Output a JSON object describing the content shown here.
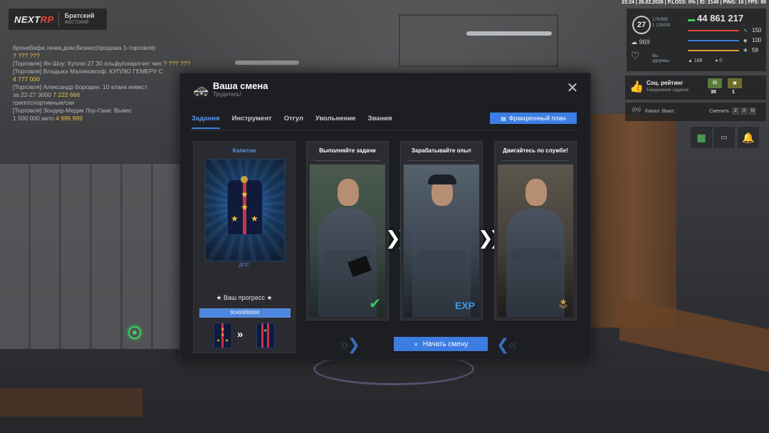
{
  "hud": {
    "status_line": "23:24 | 26.02.2026 | P.LOSS: 0% | ID: 2149 | PING: 16 | FPS: 90",
    "level": "27",
    "level_sub_1": "175/995",
    "level_sub_2": "1 125000",
    "money": "44 861 217",
    "donate": "969",
    "heart_label_1": "Вы",
    "heart_label_2": "здоровы",
    "stat_health": "150",
    "stat_armor": "100",
    "stat_hunger": "59",
    "stat_a": "188",
    "stat_b": "0",
    "rating_title": "Соц. рейтинг",
    "rating_sub": "Ежедневное задание",
    "badge1_value": "3К",
    "badge2_value": "1",
    "channel_label": "Канал: Выкл.",
    "channel_switch": "Сменить",
    "key1": "Z",
    "key2": "X",
    "key3": "N"
  },
  "logo": {
    "brand_a": "NEXT",
    "brand_b": "RP",
    "server_name": "Братский",
    "server_sub": "ЖЕСТОКИЙ"
  },
  "chat": [
    {
      "text": "бронебафа,тачка,дом,бизнес(продажа 1-торговля)",
      "price": ""
    },
    {
      "text": "",
      "price": "? ??? ???"
    },
    {
      "text": "[Торговля] Ян Шоу: Куплю 27 30 альфу/скар/счет чип",
      "price": "? ??? ???"
    },
    {
      "text": "[Торговля] Владыка Маликовсоф: КУПЛЮ ГЕМЕРУ С",
      "price": ""
    },
    {
      "text": "",
      "price": "4 777 000"
    },
    {
      "text": "[Торговля] Александр Бородин: 10 кланк инвест",
      "price": ""
    },
    {
      "text": "за 22-27 3000",
      "price": "7 222 666"
    },
    {
      "text": "грипп/спортивные/ски",
      "price": ""
    },
    {
      "text": "[Торговля] Зондер-Медик Лоу-Гани: Вывес",
      "price": ""
    },
    {
      "text": "1 500 000 авто",
      "price": "4 999 999"
    }
  ],
  "modal": {
    "title": "Ваша смена",
    "subtitle": "Трудитесь!",
    "close_label": "✕",
    "tabs": [
      "Задания",
      "Инструмент",
      "Отгул",
      "Увольнение",
      "Звания"
    ],
    "plan_button": "Фракционный план",
    "rank": {
      "title": "Капитан",
      "dept": "ДПС",
      "progress_label": "★ Ваш прогресс ★",
      "progress_text": "92493/60000",
      "progress_fraction": 1.0
    },
    "steps": [
      {
        "title": "Выполняйте задачи",
        "badge": "✔"
      },
      {
        "title": "Зарабатывайте опыт",
        "badge": "EXP"
      },
      {
        "title": "Двигайтесь по службе!",
        "badge": "★"
      }
    ],
    "start_button": "Начать смену"
  },
  "colors": {
    "accent": "#3d7de2",
    "tab_active": "#5a96e8",
    "money_icon": "#3fcf5a",
    "check": "#39c85c"
  }
}
